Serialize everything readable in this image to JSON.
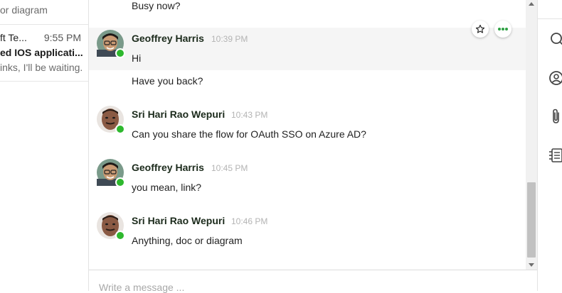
{
  "conversation_list": {
    "previous_item_snippet": "or diagram",
    "item": {
      "name": "ft Te...",
      "time": "9:55 PM",
      "subject": "ed IOS applicati...",
      "preview": "inks, I'll be waiting."
    }
  },
  "chat": {
    "top_cut_message": "Busy now?",
    "groups": [
      {
        "sender": "Geoffrey Harris",
        "time": "10:39 PM",
        "avatar": "geoffrey-avatar",
        "online": true,
        "messages": [
          "Hi",
          "Have you back?"
        ]
      },
      {
        "sender": "Sri Hari Rao Wepuri",
        "time": "10:43 PM",
        "avatar": "srihari-avatar",
        "online": true,
        "messages": [
          "Can you share the flow for OAuth SSO on Azure AD?"
        ]
      },
      {
        "sender": "Geoffrey Harris",
        "time": "10:45 PM",
        "avatar": "geoffrey-avatar",
        "online": true,
        "messages": [
          "you mean, link?"
        ]
      },
      {
        "sender": "Sri Hari Rao Wepuri",
        "time": "10:46 PM",
        "avatar": "srihari-avatar",
        "online": true,
        "messages": [
          "Anything, doc or diagram"
        ]
      }
    ],
    "hover_actions": [
      "star-icon",
      "more-options-icon"
    ]
  },
  "composer": {
    "placeholder": "Write a message ..."
  },
  "right_rail": {
    "icons": [
      "search-icon",
      "contact-icon",
      "attachment-icon",
      "notes-icon"
    ]
  },
  "colors": {
    "presence_online": "#2eb82e",
    "highlight_row": "#f5f5f5",
    "accent_green": "#2ea043"
  }
}
